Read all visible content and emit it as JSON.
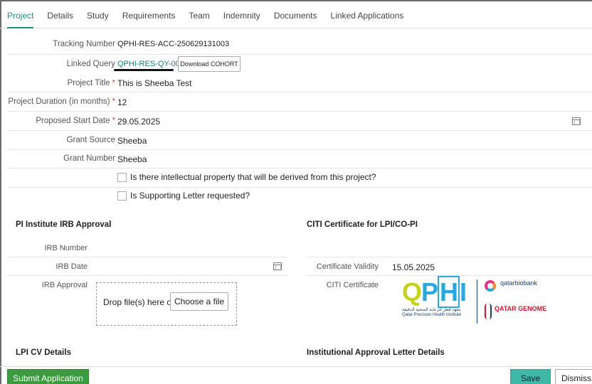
{
  "tabs": [
    {
      "label": "Project",
      "active": true
    },
    {
      "label": "Details"
    },
    {
      "label": "Study"
    },
    {
      "label": "Requirements"
    },
    {
      "label": "Team"
    },
    {
      "label": "Indemnity"
    },
    {
      "label": "Documents"
    },
    {
      "label": "Linked Applications"
    }
  ],
  "form": {
    "tracking_number": {
      "label": "Tracking Number",
      "value": "QPHI-RES-ACC-250629131003"
    },
    "linked_query": {
      "label": "Linked Query",
      "value": "QPHI-RES-QY-00044",
      "button": "Download COHORT"
    },
    "project_title": {
      "label": "Project Title",
      "value": "This is Sheeba Test",
      "required": "*"
    },
    "project_duration": {
      "label": "Project Duration (in months)",
      "value": "12",
      "required": "*"
    },
    "proposed_start_date": {
      "label": "Proposed Start Date",
      "value": "29.05.2025",
      "required": "*"
    },
    "grant_source": {
      "label": "Grant Source",
      "value": "Sheeba"
    },
    "grant_number": {
      "label": "Grant Number",
      "value": "Sheeba"
    },
    "ip_checkbox": {
      "label": "Is there intellectual property that will be derived from this project?",
      "checked": false
    },
    "support_letter_checkbox": {
      "label": "Is Supporting Letter requested?",
      "checked": false
    }
  },
  "pi_irb": {
    "title": "PI Institute IRB Approval",
    "irb_number_label": "IRB Number",
    "irb_number_value": "",
    "irb_date_label": "IRB Date",
    "irb_date_value": "",
    "irb_approval_label": "IRB Approval",
    "drop_text": "Drop file(s) here or",
    "choose_button": "Choose a file"
  },
  "citi": {
    "title": "CITI Certificate for LPI/CO-PI",
    "validity_label": "Certificate Validity",
    "validity_value": "15.05.2025",
    "certificate_label": "CITI Certificate",
    "logo_left": "QPHI",
    "logo_right_top": "qatarbiobank",
    "logo_right_bottom": "QATAR GENOME"
  },
  "lpi_cv": {
    "title": "LPI CV Details"
  },
  "inst_letter": {
    "title": "Institutional Approval Letter Details"
  },
  "footer": {
    "submit": "Submit Application",
    "save": "Save",
    "dismiss": "Dismiss"
  },
  "colors": {
    "accent": "#1e8e84",
    "submit": "#3a9b3f",
    "save": "#3fb8a7",
    "required": "#e0463a"
  }
}
